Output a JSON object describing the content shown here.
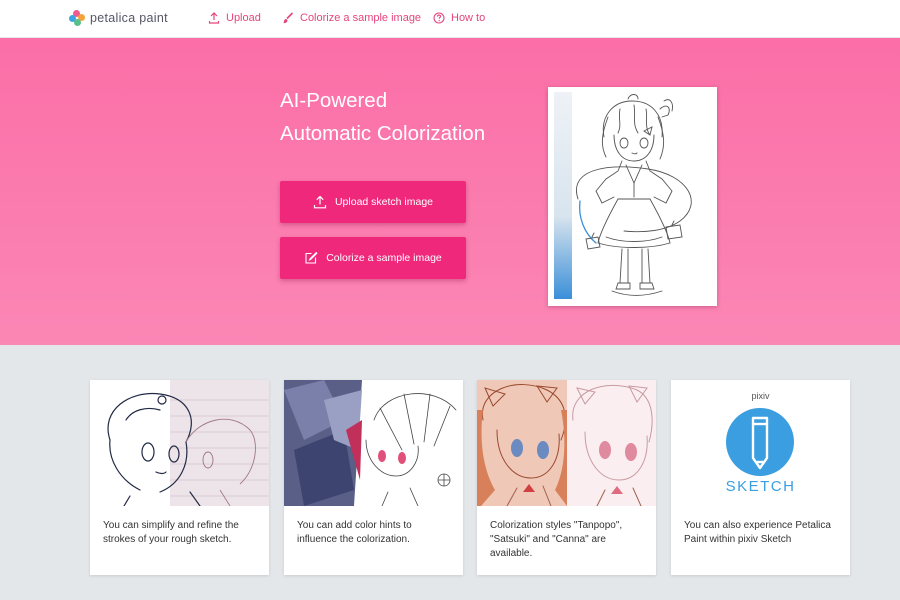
{
  "brand": {
    "name": "petalica paint"
  },
  "nav": {
    "upload_label": "Upload",
    "colorize_label": "Colorize a sample image",
    "howto_label": "How to"
  },
  "hero": {
    "title_line1": "AI-Powered",
    "title_line2": "Automatic Colorization",
    "upload_button": "Upload sketch image",
    "sample_button": "Colorize a sample image"
  },
  "features": [
    {
      "text": "You can simplify and refine the strokes of your rough sketch."
    },
    {
      "text": "You can add color hints to influence the colorization."
    },
    {
      "text": "Colorization styles \"Tanpopo\", \"Satsuki\" and \"Canna\" are available."
    },
    {
      "text": "You can also experience Petalica Paint within pixiv Sketch"
    }
  ],
  "pixiv_sketch": {
    "top_label": "pixiv",
    "bottom_label": "SKETCH"
  },
  "icons": {
    "upload": "upload-icon",
    "brush": "brush-icon",
    "help": "help-circle-icon",
    "edit": "edit-icon",
    "pencil": "pencil-icon"
  },
  "colors": {
    "accent": "#f0287b",
    "nav_link": "#e4457e",
    "hero_top": "#fb6ea7",
    "hero_bottom": "#fb87b5",
    "page_bg": "#e4e7ea",
    "pixiv_blue": "#3b9ee0"
  }
}
